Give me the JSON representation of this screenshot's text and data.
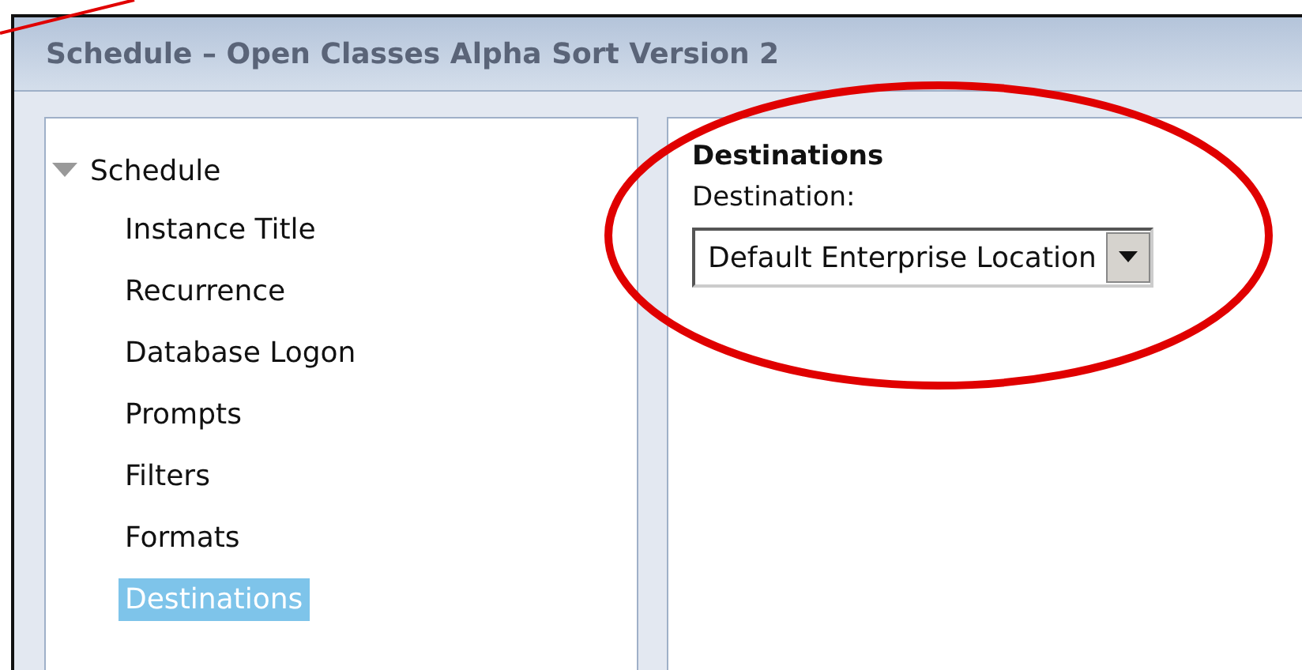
{
  "window": {
    "title": "Schedule – Open Classes Alpha Sort Version 2"
  },
  "tree": {
    "label": "Schedule",
    "expanded": true,
    "children": [
      {
        "label": "Instance Title",
        "selected": false
      },
      {
        "label": "Recurrence",
        "selected": false
      },
      {
        "label": "Database Logon",
        "selected": false
      },
      {
        "label": "Prompts",
        "selected": false
      },
      {
        "label": "Filters",
        "selected": false
      },
      {
        "label": "Formats",
        "selected": false
      },
      {
        "label": "Destinations",
        "selected": true
      }
    ]
  },
  "panel": {
    "heading": "Destinations",
    "field_label": "Destination:",
    "select_value": "Default Enterprise Location"
  }
}
